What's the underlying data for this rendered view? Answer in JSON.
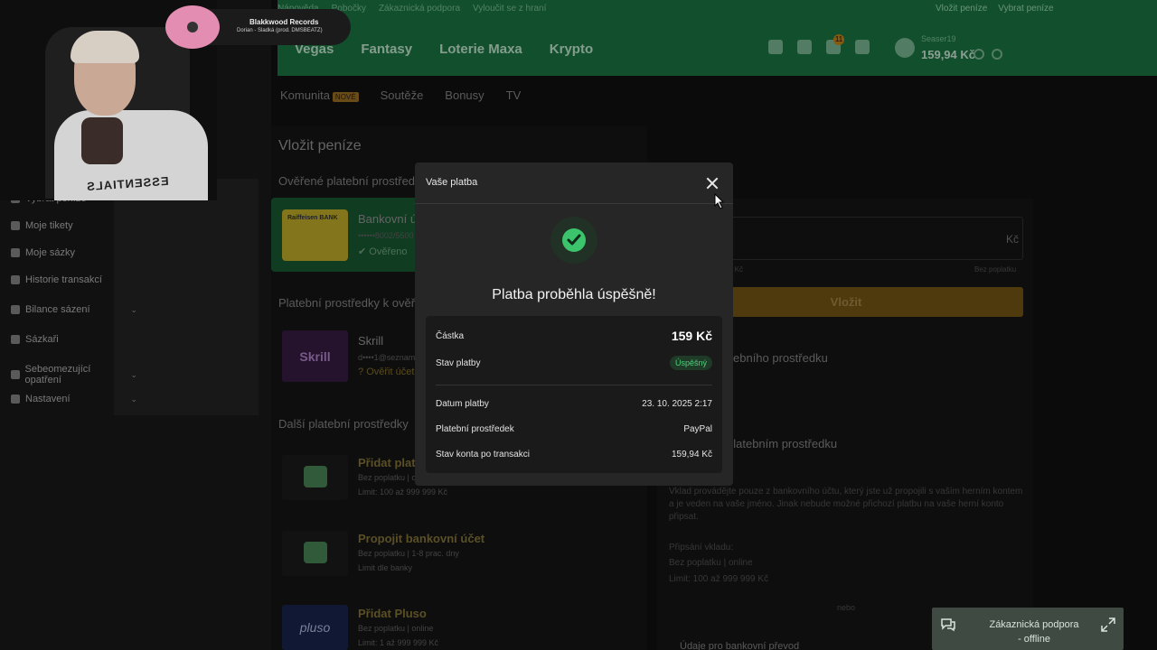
{
  "top_links": [
    "Nápověda",
    "Pobočky",
    "Zákaznická podpora",
    "Vyloučit se z hraní"
  ],
  "top_links_right": [
    "Vložit peníze",
    "Vybrat peníze"
  ],
  "main_nav": [
    "Vegas",
    "Fantasy",
    "Loterie Maxa",
    "Krypto"
  ],
  "header": {
    "notification_count": "11",
    "username": "Seaser19",
    "balance": "159,94 Kč"
  },
  "sub_nav": {
    "items": [
      "Komunita",
      "Soutěže",
      "Bonusy",
      "TV"
    ],
    "new_tag": "NOVÉ"
  },
  "sidebar": {
    "items": [
      {
        "label": "Vybrat peníze",
        "chevron": ""
      },
      {
        "label": "Moje tikety",
        "chevron": ""
      },
      {
        "label": "Moje sázky",
        "chevron": ""
      },
      {
        "label": "Historie transakcí",
        "chevron": ""
      },
      {
        "label": "Bilance sázení",
        "chevron": "⌄"
      },
      {
        "label": "Sázkaři",
        "chevron": ""
      },
      {
        "label": "Sebeomezující opatření",
        "chevron": "⌄"
      },
      {
        "label": "Nastavení",
        "chevron": "⌄"
      }
    ]
  },
  "page": {
    "title": "Vložit peníze",
    "verified_heading": "Ověřené platební prostředky",
    "bank_card_title": "Bankovní účet",
    "bank_logo_text": "Raiffeisen BANK",
    "bank_account": "••••••8002/5500",
    "bank_status": "Ověřeno",
    "to_verify_heading": "Platební prostředky k ověření",
    "skrill_logo": "Skrill",
    "skrill_title": "Skrill",
    "skrill_email": "d••••1@seznam",
    "skrill_status": "Ověřit účet",
    "other_heading": "Další platební prostředky",
    "add_card_title": "Přidat platební kartu",
    "add_card_fee": "Bez poplatku  |  o",
    "add_card_limit": "Limit: 100 až 999 999 Kč",
    "link_bank_title": "Propojit bankovní účet",
    "link_bank_fee": "Bez poplatku  |  1-8 prac. dny",
    "link_bank_limit": "Limit dle banky",
    "pluso_logo": "pluso",
    "pluso_title": "Přidat Pluso",
    "pluso_fee": "Bez poplatku  |  online",
    "pluso_limit": "Limit: 1 až 999 999 Kč"
  },
  "right_panel": {
    "amount_unit": "Kč",
    "hint_left": "4 Kč",
    "hint_right": "Bez poplatku",
    "deposit_button": "Vložit",
    "heading_1": "ebního prostředku",
    "heading_2": "platebním prostředku",
    "info_text": "Vklad provádějte pouze z bankovního účtu, který jste už propojili s vaším herním kontem a je veden na vaše jméno. Jinak nebude možné přichozí platbu na vaše herní konto připsat.",
    "credit_heading": "Připsání vkladu:",
    "credit_fee": "Bez poplatku  |  online",
    "credit_limit": "Limit: 100 až 999 999 Kč",
    "or": "nebo",
    "bottom_heading": "Údaje pro bankovní převod"
  },
  "music": {
    "title": "Blakkwood Records",
    "subtitle": "Dorian - Sladká (prod. DMSBEATZ)"
  },
  "webcam": {
    "shirt_text": "ESSENTIALS"
  },
  "modal": {
    "title": "Vaše platba",
    "message": "Platba proběhla úspěšně!",
    "amount_label": "Částka",
    "amount_value": "159 Kč",
    "status_label": "Stav platby",
    "status_value": "Úspěšný",
    "date_label": "Datum platby",
    "date_value": "23. 10. 2025 2:17",
    "method_label": "Platební prostředek",
    "method_value": "PayPal",
    "balance_label": "Stav konta po transakci",
    "balance_value": "159,94 Kč"
  },
  "support": {
    "line1": "Zákaznická podpora",
    "line2": "- offline"
  }
}
